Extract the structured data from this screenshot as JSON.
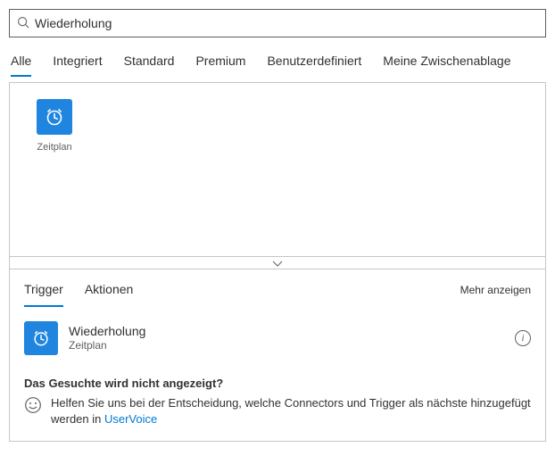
{
  "search": {
    "value": "Wiederholung"
  },
  "tabs": {
    "all": "Alle",
    "builtin": "Integriert",
    "standard": "Standard",
    "premium": "Premium",
    "custom": "Benutzerdefiniert",
    "clipboard": "Meine Zwischenablage"
  },
  "connectors": {
    "zeitplan": {
      "label": "Zeitplan"
    }
  },
  "subTabs": {
    "trigger": "Trigger",
    "actions": "Aktionen",
    "more": "Mehr anzeigen"
  },
  "triggerItem": {
    "title": "Wiederholung",
    "subtitle": "Zeitplan"
  },
  "footer": {
    "heading": "Das Gesuchte wird nicht angezeigt?",
    "body": "Helfen Sie uns bei der Entscheidung, welche Connectors und Trigger als nächste hinzugefügt werden in ",
    "linkText": "UserVoice"
  }
}
